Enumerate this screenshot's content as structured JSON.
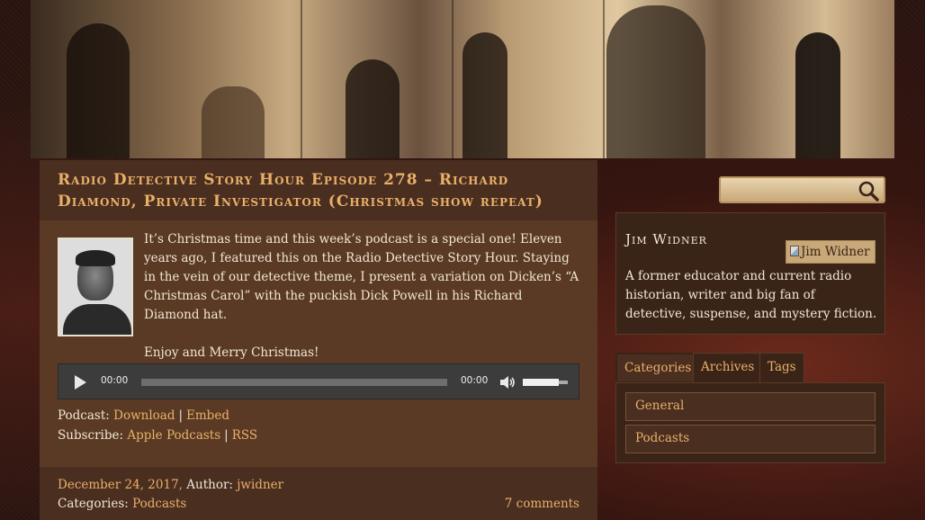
{
  "post": {
    "title": "Radio Detective Story Hour Episode 278 – Richard Diamond, Private Investigator (Christmas show repeat)",
    "paragraphs": [
      "It’s Christmas time and this week’s podcast is a special one! Eleven years ago, I featured this on the Radio Detective Story Hour. Staying in the vein of our detective theme, I present a variation on Dicken’s “A Christmas Carol” with the puckish Dick Powell in his Richard Diamond hat.",
      "Enjoy and Merry Christmas!"
    ],
    "player": {
      "current_time": "00:00",
      "duration": "00:00",
      "progress": 0,
      "volume": 0.8
    },
    "podcast_label": "Podcast:",
    "download_label": "Download",
    "embed_label": "Embed",
    "separator": "|",
    "subscribe_label": "Subscribe:",
    "apple_label": "Apple Podcasts",
    "rss_label": "RSS",
    "date": "December 24, 2017,",
    "author_label": "Author:",
    "author": "jwidner",
    "categories_label": "Categories:",
    "category": "Podcasts",
    "comments": "7 comments"
  },
  "sidebar": {
    "search_placeholder": "",
    "author_box": {
      "name": "Jim Widner",
      "image_alt": "Jim Widner",
      "bio": "A former educator and current radio historian, writer and big fan of detective, suspense, and mystery fiction."
    },
    "tabs": [
      {
        "label": "Categories"
      },
      {
        "label": "Archives"
      },
      {
        "label": "Tags"
      }
    ],
    "categories": [
      {
        "label": "General"
      },
      {
        "label": "Podcasts"
      }
    ]
  },
  "colors": {
    "link": "#e8b06a",
    "text": "#f2e6d4",
    "panel": "#3a2418",
    "panel_light": "#5a3a24"
  }
}
